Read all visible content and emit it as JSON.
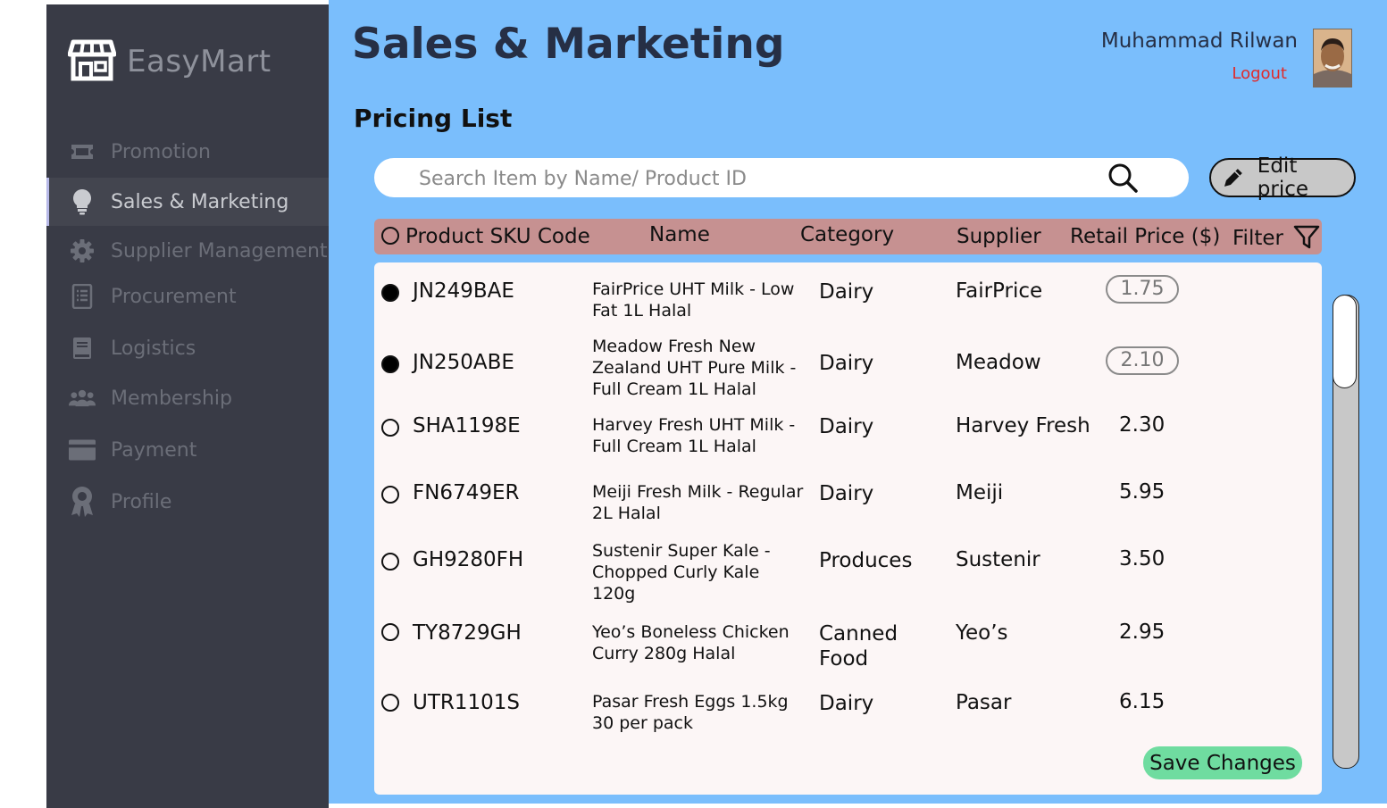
{
  "brand": {
    "name": "EasyMart"
  },
  "sidebar": {
    "items": [
      {
        "label": "Promotion",
        "icon": "ticket-icon",
        "active": false
      },
      {
        "label": "Sales & Marketing",
        "icon": "lightbulb-icon",
        "active": true
      },
      {
        "label": "Supplier Management",
        "icon": "gear-icon",
        "active": false
      },
      {
        "label": "Procurement",
        "icon": "receipt-icon",
        "active": false
      },
      {
        "label": "Logistics",
        "icon": "book-icon",
        "active": false
      },
      {
        "label": "Membership",
        "icon": "users-icon",
        "active": false
      },
      {
        "label": "Payment",
        "icon": "card-icon",
        "active": false
      },
      {
        "label": "Profile",
        "icon": "award-icon",
        "active": false
      }
    ]
  },
  "header": {
    "title": "Sales & Marketing",
    "user_name": "Muhammad Rilwan",
    "logout_label": "Logout"
  },
  "main": {
    "section_title": "Pricing List",
    "search_placeholder": "Search Item by Name/ Product ID",
    "edit_price_label": "Edit price",
    "save_label": "Save Changes"
  },
  "table": {
    "headers": {
      "sku": "Product SKU Code",
      "name": "Name",
      "category": "Category",
      "supplier": "Supplier",
      "price": "Retail Price ($)",
      "filter": "Filter"
    },
    "rows": [
      {
        "sku": "JN249BAE",
        "name": "FairPrice UHT Milk - Low Fat 1L Halal",
        "category": "Dairy",
        "supplier": "FairPrice",
        "price": "1.75",
        "selected": true
      },
      {
        "sku": "JN250ABE",
        "name": "Meadow Fresh New Zealand UHT Pure Milk - Full Cream 1L Halal",
        "category": "Dairy",
        "supplier": "Meadow",
        "price": "2.10",
        "selected": true
      },
      {
        "sku": "SHA1198E",
        "name": "Harvey Fresh UHT Milk - Full Cream 1L Halal",
        "category": "Dairy",
        "supplier": "Harvey Fresh",
        "price": "2.30",
        "selected": false
      },
      {
        "sku": "FN6749ER",
        "name": "Meiji Fresh Milk - Regular 2L Halal",
        "category": "Dairy",
        "supplier": "Meiji",
        "price": "5.95",
        "selected": false
      },
      {
        "sku": "GH9280FH",
        "name": "Sustenir Super Kale - Chopped Curly Kale 120g",
        "category": "Produces",
        "supplier": "Sustenir",
        "price": "3.50",
        "selected": false
      },
      {
        "sku": "TY8729GH",
        "name": "Yeo’s Boneless Chicken Curry 280g Halal",
        "category": "Canned Food",
        "supplier": "Yeo’s",
        "price": "2.95",
        "selected": false
      },
      {
        "sku": "UTR1101S",
        "name": "Pasar Fresh Eggs 1.5kg 30 per pack",
        "category": "Dairy",
        "supplier": "Pasar",
        "price": "6.15",
        "selected": false
      }
    ]
  },
  "colors": {
    "sidebar_bg": "#393b46",
    "main_bg": "#7abefc",
    "table_header_bg": "#c69191",
    "save_button": "#6fdca0",
    "logout": "#e02a2a"
  }
}
